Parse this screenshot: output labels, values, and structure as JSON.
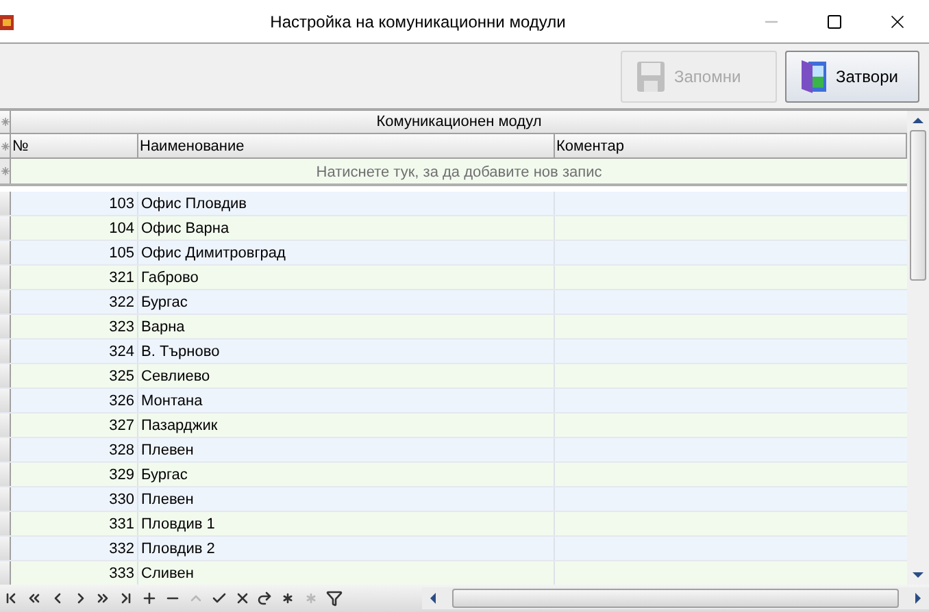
{
  "window": {
    "title": "Настройка на комуникационни модули"
  },
  "toolbar": {
    "buttons": [
      {
        "kind": "save",
        "label": "Запомни",
        "disabled": true
      },
      {
        "kind": "close",
        "label": "Затвори",
        "disabled": false
      }
    ]
  },
  "grid": {
    "band": "Комуникационен модул",
    "columns": [
      "№",
      "Наименование",
      "Коментар"
    ],
    "new_row_hint": "Натиснете тук, за да добавите нов запис",
    "rows": [
      {
        "no": "103",
        "name": "Офис Пловдив"
      },
      {
        "no": "104",
        "name": "Офис Варна"
      },
      {
        "no": "105",
        "name": "Офис Димитровград"
      },
      {
        "no": "321",
        "name": "Габрово"
      },
      {
        "no": "322",
        "name": "Бургас"
      },
      {
        "no": "323",
        "name": "Варна"
      },
      {
        "no": "324",
        "name": "В. Търново"
      },
      {
        "no": "325",
        "name": "Севлиево"
      },
      {
        "no": "326",
        "name": "Монтана"
      },
      {
        "no": "327",
        "name": "Пазарджик"
      },
      {
        "no": "328",
        "name": "Плевен"
      },
      {
        "no": "329",
        "name": "Бургас"
      },
      {
        "no": "330",
        "name": "Плевен"
      },
      {
        "no": "331",
        "name": "Пловдив 1"
      },
      {
        "no": "332",
        "name": "Пловдив 2"
      },
      {
        "no": "333",
        "name": "Сливен"
      }
    ]
  },
  "navigator": [
    {
      "kind": "first",
      "disabled": false
    },
    {
      "kind": "prev_page",
      "disabled": false
    },
    {
      "kind": "prev",
      "disabled": false
    },
    {
      "kind": "next",
      "disabled": false
    },
    {
      "kind": "next_page",
      "disabled": false
    },
    {
      "kind": "last",
      "disabled": false
    },
    {
      "kind": "insert",
      "disabled": false
    },
    {
      "kind": "delete",
      "disabled": false
    },
    {
      "kind": "edit",
      "disabled": true
    },
    {
      "kind": "post",
      "disabled": false
    },
    {
      "kind": "cancel",
      "disabled": false
    },
    {
      "kind": "refresh",
      "disabled": false
    },
    {
      "kind": "bookmark",
      "disabled": false
    },
    {
      "kind": "goto_bookmark",
      "disabled": true
    },
    {
      "kind": "filter",
      "disabled": false
    }
  ]
}
